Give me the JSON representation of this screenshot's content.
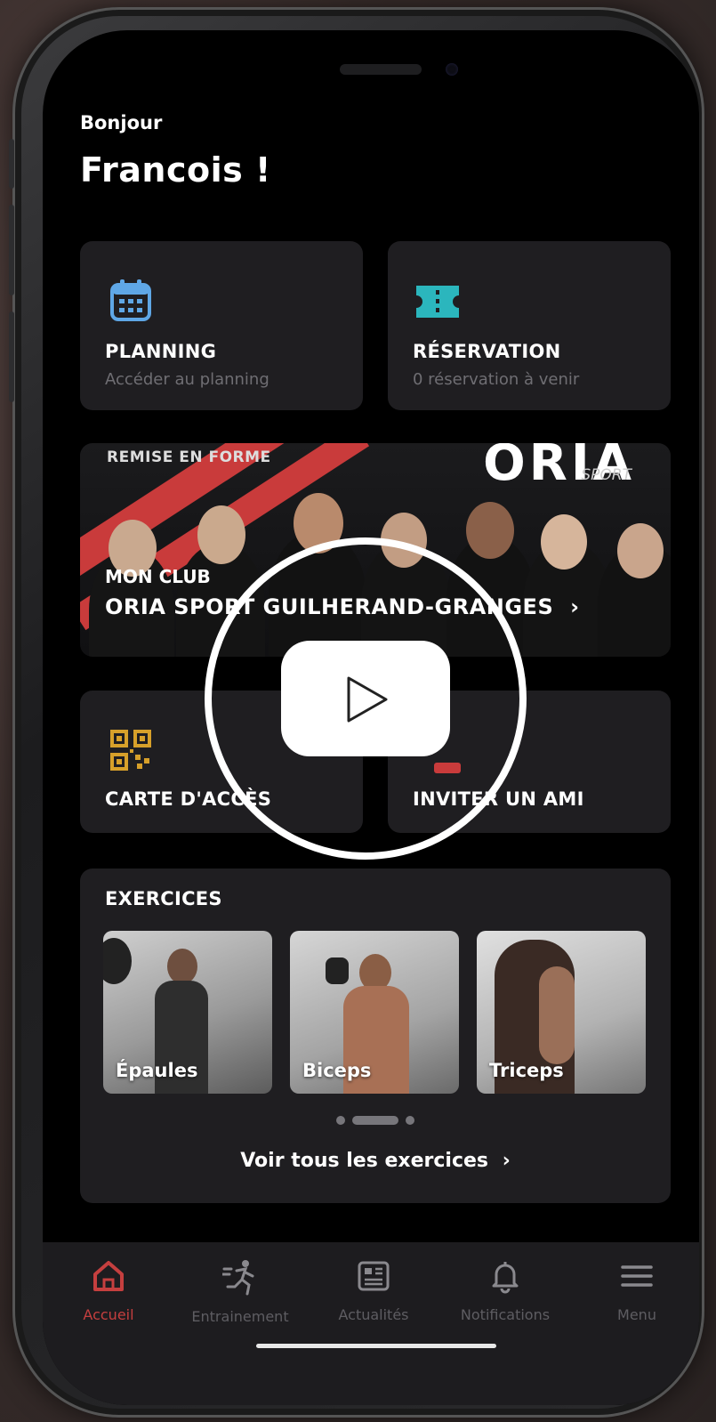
{
  "greeting": {
    "hello": "Bonjour",
    "name": "Francois !"
  },
  "cards": {
    "planning": {
      "title": "PLANNING",
      "subtitle": "Accéder au planning",
      "icon": "calendar-icon"
    },
    "reservation": {
      "title": "RÉSERVATION",
      "subtitle": "0 réservation à venir",
      "icon": "ticket-icon"
    },
    "access_card": {
      "title": "CARTE D'ACCÈS",
      "icon": "qr-code-icon"
    },
    "invite": {
      "title": "INVITER UN AMI",
      "icon": "add-friend-icon"
    }
  },
  "club_banner": {
    "tagline": "REMISE EN FORME",
    "brand": "ORIA",
    "brand_sub": "SPORT",
    "label": "MON CLUB",
    "name": "ORIA SPORT GUILHERAND-GRANGES",
    "chevron": "›"
  },
  "exercises": {
    "title": "EXERCICES",
    "items": [
      {
        "label": "Épaules"
      },
      {
        "label": "Biceps"
      },
      {
        "label": "Triceps"
      }
    ],
    "see_all": "Voir tous les exercices",
    "see_all_chevron": "›"
  },
  "tabbar": {
    "items": [
      {
        "label": "Accueil",
        "icon": "home-icon",
        "active": true
      },
      {
        "label": "Entrainement",
        "icon": "running-icon",
        "active": false
      },
      {
        "label": "Actualités",
        "icon": "news-icon",
        "active": false
      },
      {
        "label": "Notifications",
        "icon": "bell-icon",
        "active": false
      },
      {
        "label": "Menu",
        "icon": "menu-icon",
        "active": false
      }
    ]
  },
  "video_overlay": {
    "icon": "play-icon"
  },
  "colors": {
    "accent_red": "#c93b3b",
    "teal": "#2bb6bd",
    "calendar_blue": "#5fa7e6",
    "qr_gold": "#d7a02a",
    "card_bg": "#1f1e21"
  }
}
